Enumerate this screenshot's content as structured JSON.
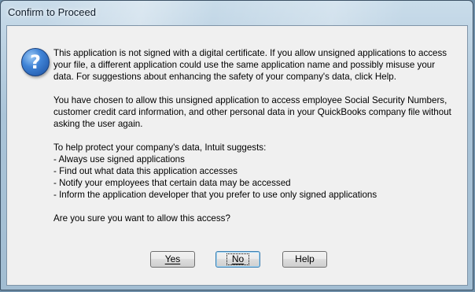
{
  "window": {
    "title": "Confirm to Proceed"
  },
  "icons": {
    "question": "question-icon"
  },
  "message": {
    "para1": "This application is not signed with a digital certificate.  If you allow unsigned applications to access your file, a different application could use the same application name and possibly misuse your data.  For suggestions about enhancing the safety of your company's data, click Help.",
    "para2": "You have chosen to allow this unsigned application to access employee Social Security Numbers, customer credit card information, and other personal data in your QuickBooks company file without asking the user again.",
    "para3_intro": "To help protect your company's data, Intuit suggests:",
    "suggestions": [
      "- Always use signed applications",
      "- Find out what data this application accesses",
      "- Notify your employees that certain data may be accessed",
      "- Inform the application developer that you prefer to use only signed applications"
    ],
    "question": "Are you sure you want to allow this access?"
  },
  "buttons": {
    "yes": "Yes",
    "no": "No",
    "help": "Help"
  }
}
